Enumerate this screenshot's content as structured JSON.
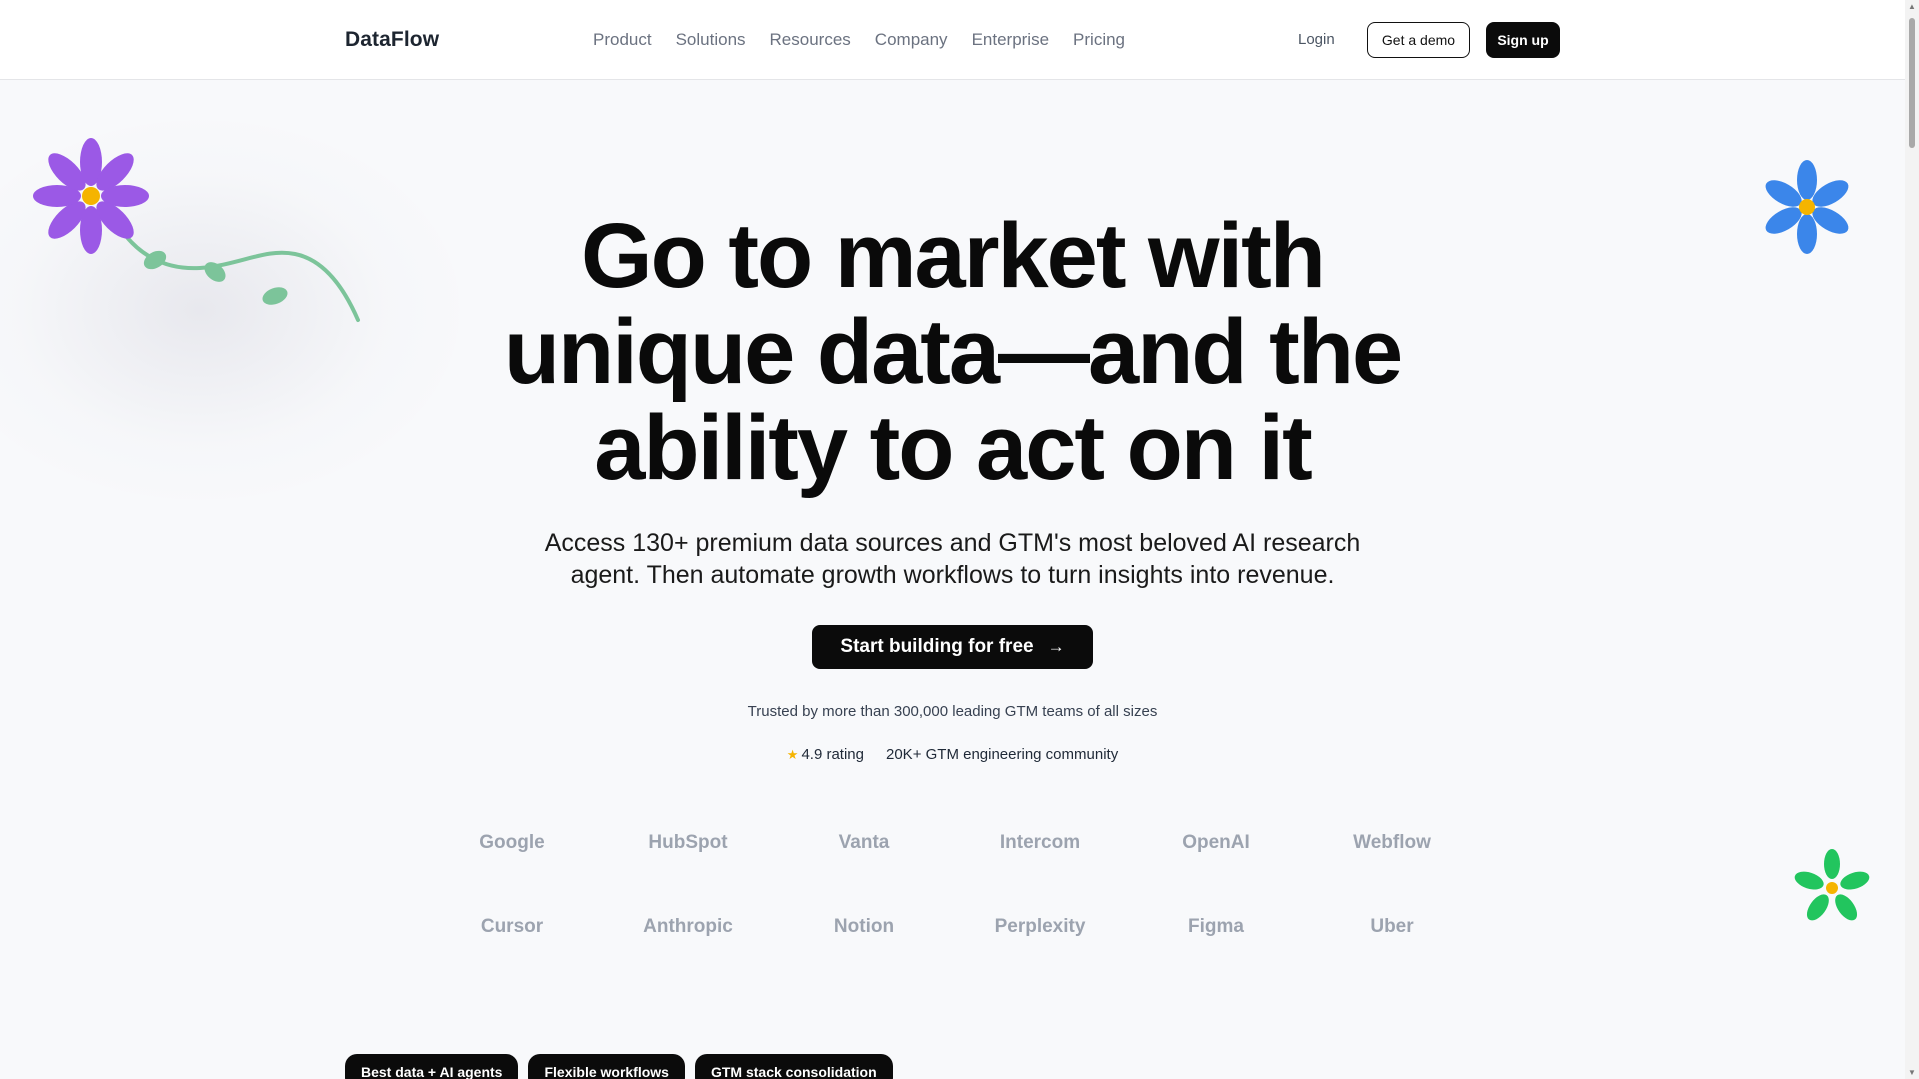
{
  "header": {
    "logo": "DataFlow",
    "nav": [
      "Product",
      "Solutions",
      "Resources",
      "Company",
      "Enterprise",
      "Pricing"
    ],
    "login": "Login",
    "demo_button": "Get a demo",
    "signup_button": "Sign up"
  },
  "hero": {
    "title_line1": "Go to market with",
    "title_line2": "unique data—and the",
    "title_line3": "ability to act on it",
    "subtitle_line1": "Access 130+ premium data sources and GTM's most beloved AI research",
    "subtitle_line2": "agent. Then automate growth workflows to turn insights into revenue.",
    "cta": "Start building for free",
    "trusted": "Trusted by more than 300,000 leading GTM teams of all sizes",
    "rating": "4.9 rating",
    "community": "20K+ GTM engineering community"
  },
  "logos": [
    "Google",
    "HubSpot",
    "Vanta",
    "Intercom",
    "OpenAI",
    "Webflow",
    "Cursor",
    "Anthropic",
    "Notion",
    "Perplexity",
    "Figma",
    "Uber"
  ],
  "tabs": [
    "Best data + AI agents",
    "Flexible workflows",
    "GTM stack consolidation"
  ],
  "colors": {
    "background": "#f8f9fb",
    "primary": "#0b0b0b",
    "flower_purple": "#9b59e6",
    "flower_blue": "#3b86ea",
    "flower_green": "#22c55e",
    "flower_center": "#f5b400",
    "stem": "#7cc49a"
  },
  "icons": {
    "cta_arrow": "arrow-right-icon",
    "rating_star": "star-icon"
  }
}
